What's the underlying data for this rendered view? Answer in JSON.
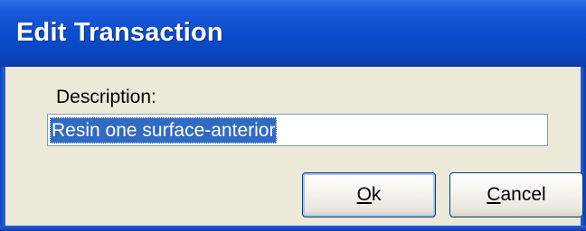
{
  "window": {
    "title": "Edit Transaction"
  },
  "form": {
    "description_label": "Description:",
    "description_value": "Resin one surface-anterior"
  },
  "buttons": {
    "ok": {
      "mnemonic": "O",
      "rest": "k"
    },
    "cancel": {
      "mnemonic": "C",
      "rest": "ancel"
    }
  },
  "colors": {
    "titlebar": "#0a4ccc",
    "dialog_bg": "#ece9d8",
    "selection": "#316ac5"
  }
}
